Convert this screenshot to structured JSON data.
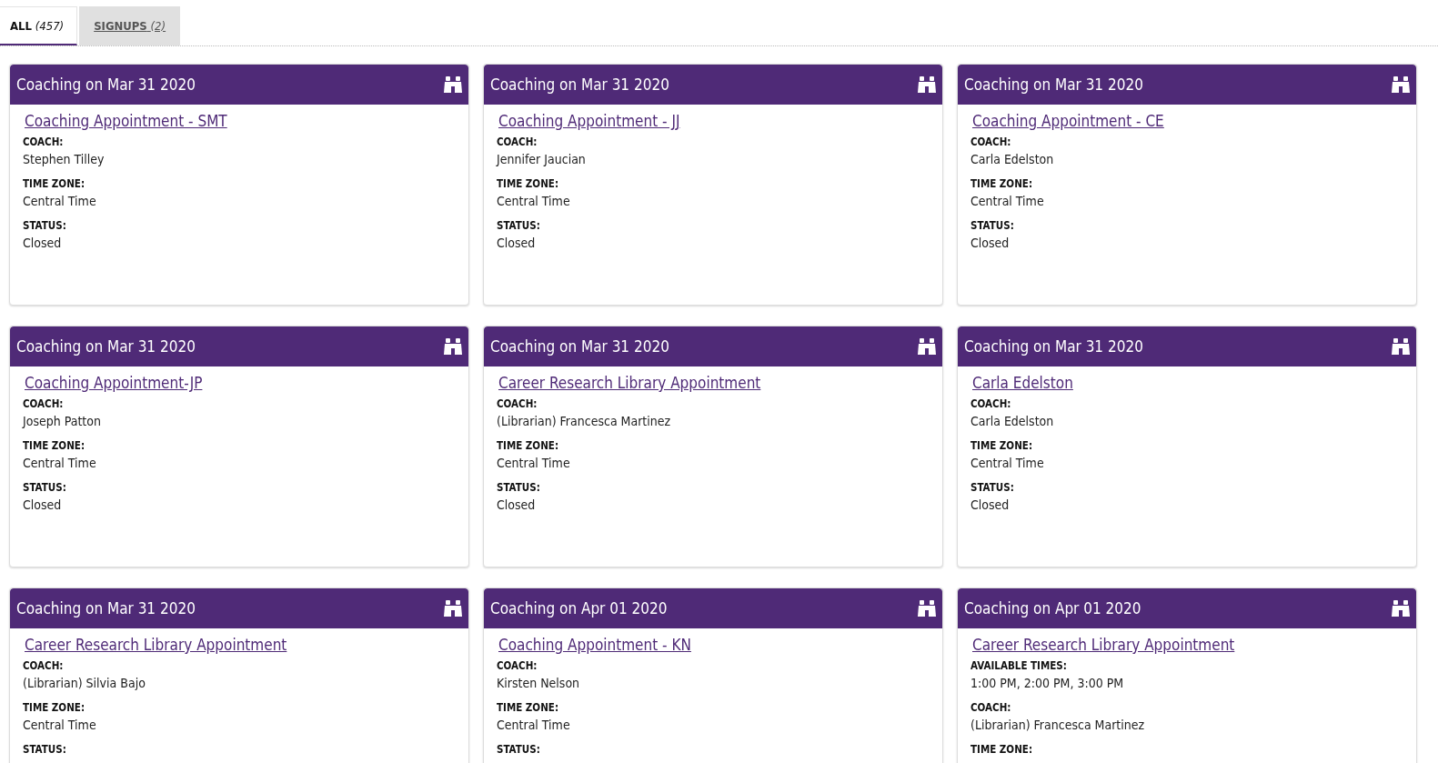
{
  "tabs": [
    {
      "label": "**ALL** *(457)*",
      "selected": true
    },
    {
      "label": "**SIGNUPS** *(2)*",
      "selected": false
    }
  ],
  "cards": [
    {
      "title": "Coaching on Mar 31 2020",
      "link": "Coaching Appointment - SMT",
      "fields": [
        {
          "label": "COACH:",
          "value": "Stephen Tilley"
        },
        {
          "label": "TIME ZONE:",
          "value": "Central Time"
        },
        {
          "label": "STATUS:",
          "value": "Closed"
        }
      ]
    },
    {
      "title": "Coaching on Mar 31 2020",
      "link": "Coaching Appointment - JJ",
      "fields": [
        {
          "label": "COACH:",
          "value": "Jennifer Jaucian"
        },
        {
          "label": "TIME ZONE:",
          "value": "Central Time"
        },
        {
          "label": "STATUS:",
          "value": "Closed"
        }
      ]
    },
    {
      "title": "Coaching on Mar 31 2020",
      "link": "Coaching Appointment - CE",
      "fields": [
        {
          "label": "COACH:",
          "value": "Carla Edelston"
        },
        {
          "label": "TIME ZONE:",
          "value": "Central Time"
        },
        {
          "label": "STATUS:",
          "value": "Closed"
        }
      ]
    },
    {
      "title": "Coaching on Mar 31 2020",
      "link": "Coaching Appointment-JP",
      "fields": [
        {
          "label": "COACH:",
          "value": "Joseph Patton"
        },
        {
          "label": "TIME ZONE:",
          "value": "Central Time"
        },
        {
          "label": "STATUS:",
          "value": "Closed"
        }
      ]
    },
    {
      "title": "Coaching on Mar 31 2020",
      "link": "Career Research Library Appointment",
      "fields": [
        {
          "label": "COACH:",
          "value": "(Librarian) Francesca Martinez"
        },
        {
          "label": "TIME ZONE:",
          "value": "Central Time"
        },
        {
          "label": "STATUS:",
          "value": "Closed"
        }
      ]
    },
    {
      "title": "Coaching on Mar 31 2020",
      "link": "Carla Edelston",
      "fields": [
        {
          "label": "COACH:",
          "value": "Carla Edelston"
        },
        {
          "label": "TIME ZONE:",
          "value": "Central Time"
        },
        {
          "label": "STATUS:",
          "value": "Closed"
        }
      ]
    },
    {
      "title": "Coaching on Mar 31 2020",
      "link": "Career Research Library Appointment",
      "fields": [
        {
          "label": "COACH:",
          "value": "(Librarian) Silvia Bajo"
        },
        {
          "label": "TIME ZONE:",
          "value": "Central Time"
        },
        {
          "label": "STATUS:"
        }
      ]
    },
    {
      "title": "Coaching on Apr 01 2020",
      "link": "Coaching Appointment - KN",
      "fields": [
        {
          "label": "COACH:",
          "value": "Kirsten Nelson"
        },
        {
          "label": "TIME ZONE:",
          "value": "Central Time"
        },
        {
          "label": "STATUS:"
        }
      ]
    },
    {
      "title": "Coaching on Apr 01 2020",
      "link": "Career Research Library Appointment",
      "fields": [
        {
          "label": "AVAILABLE TIMES:",
          "value": "1:00 PM, 2:00 PM, 3:00 PM"
        },
        {
          "label": "COACH:",
          "value": "(Librarian) Francesca Martinez"
        },
        {
          "label": "TIME ZONE:"
        }
      ]
    }
  ]
}
